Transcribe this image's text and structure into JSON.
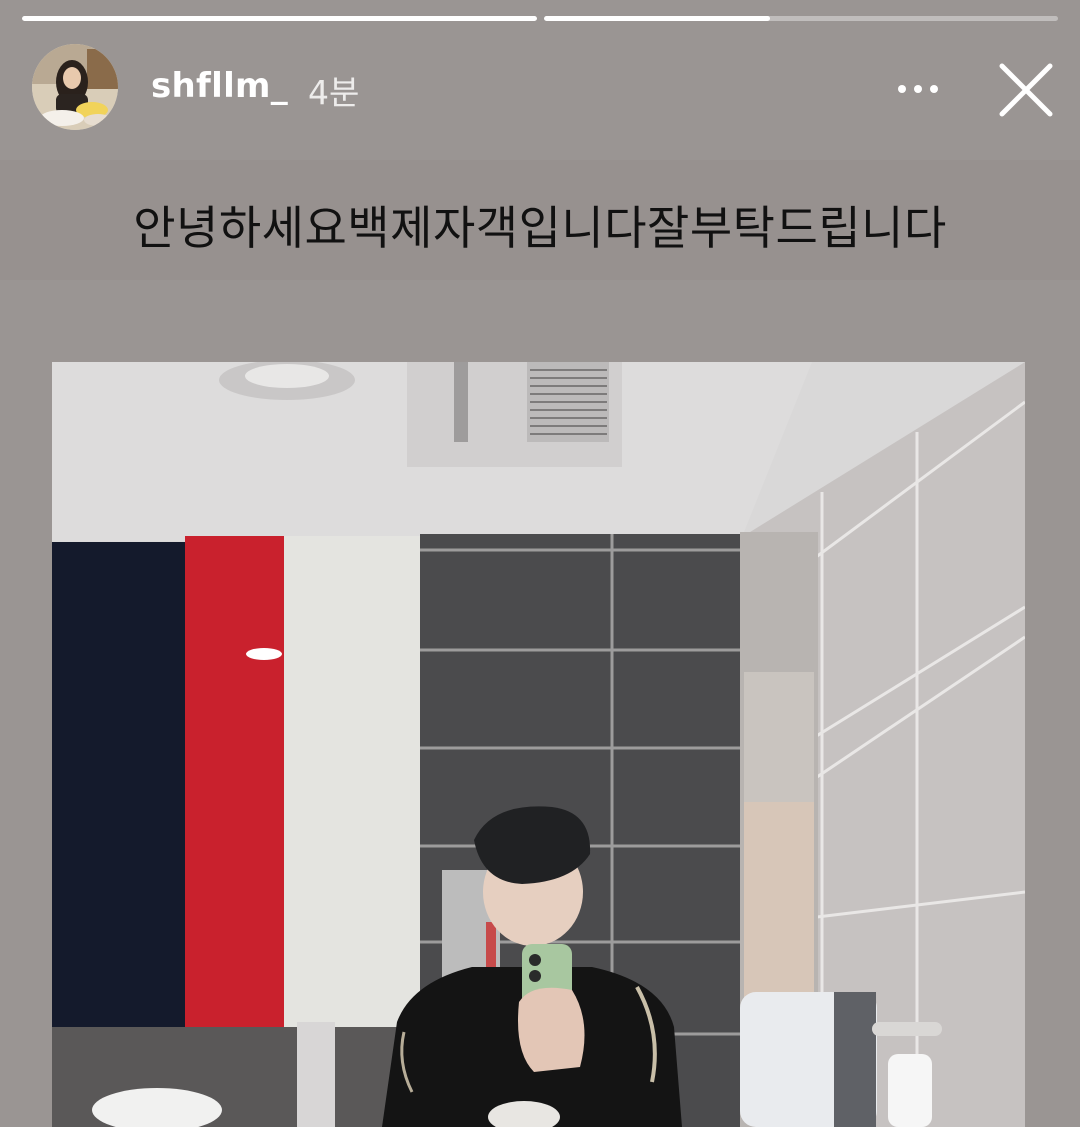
{
  "story": {
    "progress": [
      1.0,
      0.44
    ],
    "user": {
      "username": "shfllm_",
      "timestamp": "4분"
    },
    "caption": "안녕하세요백제자객입니다잘부탁드립니다",
    "icons": {
      "more": "more-horizontal-icon",
      "close": "close-icon"
    },
    "colors": {
      "background": "#9a9593",
      "text": "#ffffff",
      "caption": "#111111"
    }
  }
}
